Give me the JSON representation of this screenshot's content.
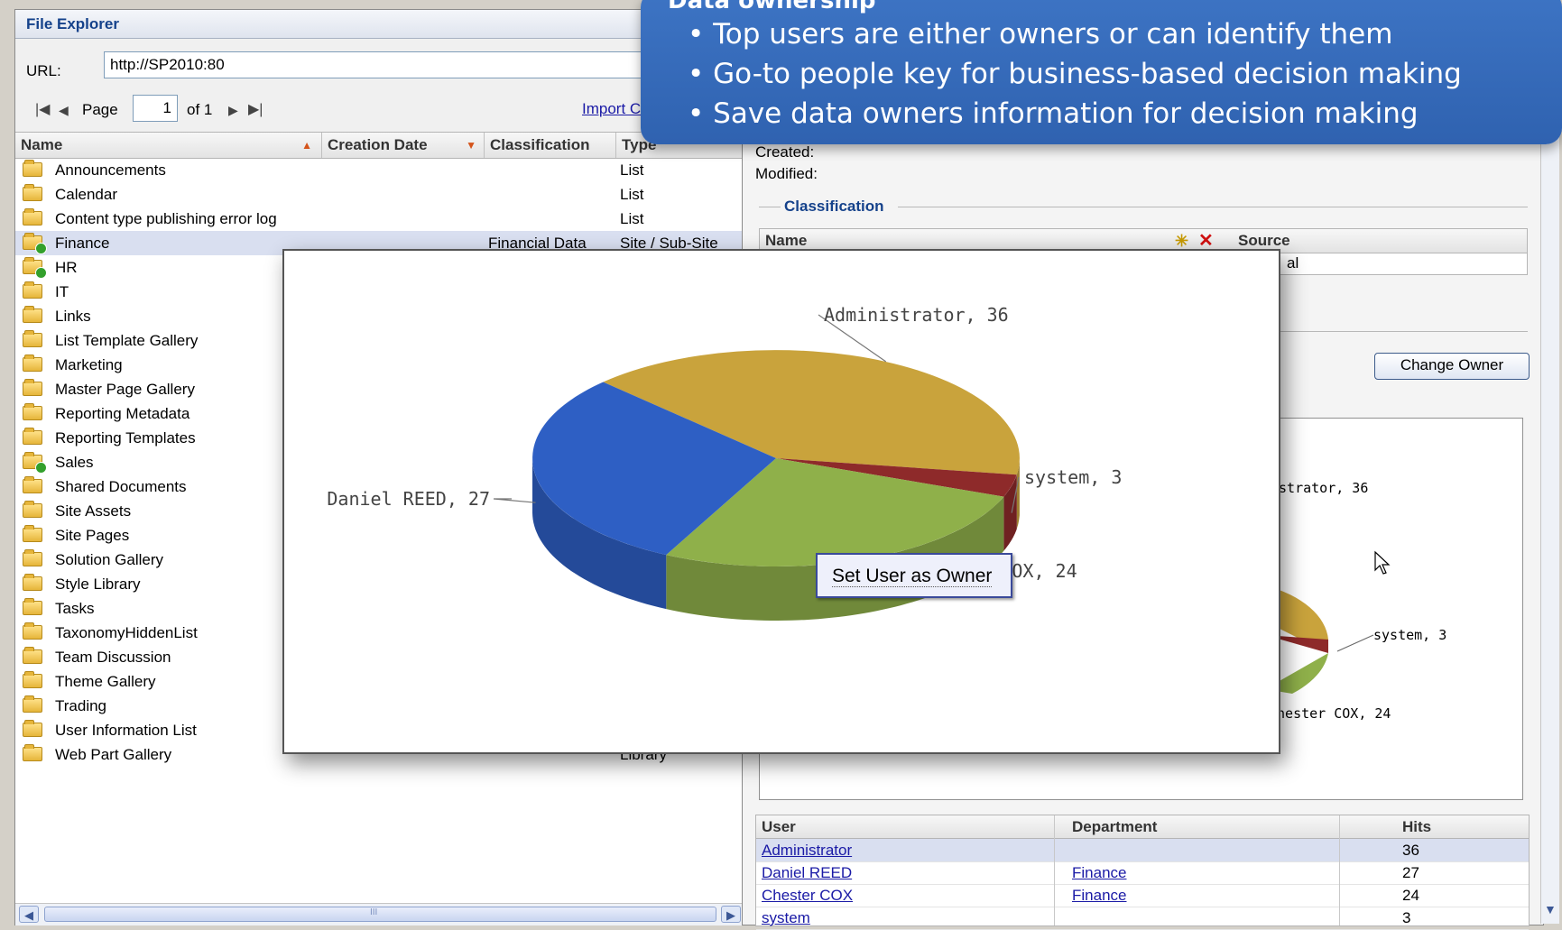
{
  "file_explorer": {
    "title": "File Explorer",
    "url_label": "URL:",
    "url_value": "http://SP2010:80",
    "page_label": "Page",
    "page_value": "1",
    "page_of": "of 1",
    "import_link": "Import C",
    "columns": [
      "Name",
      "Creation Date",
      "Classification",
      "Type"
    ],
    "rows": [
      {
        "name": "Announcements",
        "classification": "",
        "type": "List",
        "badge": false
      },
      {
        "name": "Calendar",
        "classification": "",
        "type": "List",
        "badge": false
      },
      {
        "name": "Content type publishing error log",
        "classification": "",
        "type": "List",
        "badge": false
      },
      {
        "name": "Finance",
        "classification": "Financial Data",
        "type": "Site / Sub-Site",
        "badge": true
      },
      {
        "name": "HR",
        "classification": "",
        "type": "",
        "badge": true
      },
      {
        "name": "IT",
        "classification": "",
        "type": "",
        "badge": false
      },
      {
        "name": "Links",
        "classification": "",
        "type": "",
        "badge": false
      },
      {
        "name": "List Template Gallery",
        "classification": "",
        "type": "",
        "badge": false
      },
      {
        "name": "Marketing",
        "classification": "",
        "type": "",
        "badge": false
      },
      {
        "name": "Master Page Gallery",
        "classification": "",
        "type": "",
        "badge": false
      },
      {
        "name": "Reporting Metadata",
        "classification": "",
        "type": "",
        "badge": false
      },
      {
        "name": "Reporting Templates",
        "classification": "",
        "type": "",
        "badge": false
      },
      {
        "name": "Sales",
        "classification": "",
        "type": "",
        "badge": true
      },
      {
        "name": "Shared Documents",
        "classification": "",
        "type": "",
        "badge": false
      },
      {
        "name": "Site Assets",
        "classification": "",
        "type": "",
        "badge": false
      },
      {
        "name": "Site Pages",
        "classification": "",
        "type": "",
        "badge": false
      },
      {
        "name": "Solution Gallery",
        "classification": "",
        "type": "",
        "badge": false
      },
      {
        "name": "Style Library",
        "classification": "",
        "type": "",
        "badge": false
      },
      {
        "name": "Tasks",
        "classification": "",
        "type": "",
        "badge": false
      },
      {
        "name": "TaxonomyHiddenList",
        "classification": "",
        "type": "",
        "badge": false
      },
      {
        "name": "Team Discussion",
        "classification": "",
        "type": "",
        "badge": false
      },
      {
        "name": "Theme Gallery",
        "classification": "",
        "type": "",
        "badge": false
      },
      {
        "name": "Trading",
        "classification": "",
        "type": "",
        "badge": false
      },
      {
        "name": "User Information List",
        "classification": "",
        "type": "",
        "badge": false
      },
      {
        "name": "Web Part Gallery",
        "classification": "",
        "type": "Library",
        "badge": false
      }
    ],
    "scroll_mid": "III"
  },
  "details": {
    "created_label": "Created:",
    "modified_label": "Modified:",
    "classification_legend": "Classification",
    "cls_columns": [
      "Name",
      "Source"
    ],
    "cls_partial": "al",
    "change_owner": "Change Owner",
    "users_columns": [
      "User",
      "Department",
      "Hits"
    ],
    "users": [
      {
        "user": "Administrator",
        "department": "",
        "hits": "36"
      },
      {
        "user": "Daniel REED",
        "department": "Finance",
        "hits": "27"
      },
      {
        "user": "Chester COX",
        "department": "Finance",
        "hits": "24"
      },
      {
        "user": "system",
        "department": "",
        "hits": "3"
      }
    ],
    "small_chart_labels": [
      "istrator, 36",
      "system, 3",
      "Chester COX, 24"
    ]
  },
  "callout": {
    "title": "Data ownership",
    "bullets": [
      "• Top users are either owners or can identify them",
      "• Go-to people key for business-based decision making",
      "• Save data owners information for decision making"
    ]
  },
  "tooltip": "Set User as Owner",
  "colors": {
    "administrator": "#c9a33c",
    "daniel": "#2e5fc4",
    "chester": "#8fb04a",
    "system": "#8e2a2a",
    "callout": "#3568b9"
  },
  "chart_data": {
    "type": "pie",
    "title": "",
    "slices": [
      {
        "label": "Administrator, 36",
        "name": "Administrator",
        "value": 36
      },
      {
        "label": "system, 3",
        "name": "system",
        "value": 3
      },
      {
        "label": "Chester COX, 24",
        "name": "Chester COX",
        "value": 24
      },
      {
        "label": "Daniel REED, 27",
        "name": "Daniel REED",
        "value": 27
      }
    ]
  }
}
